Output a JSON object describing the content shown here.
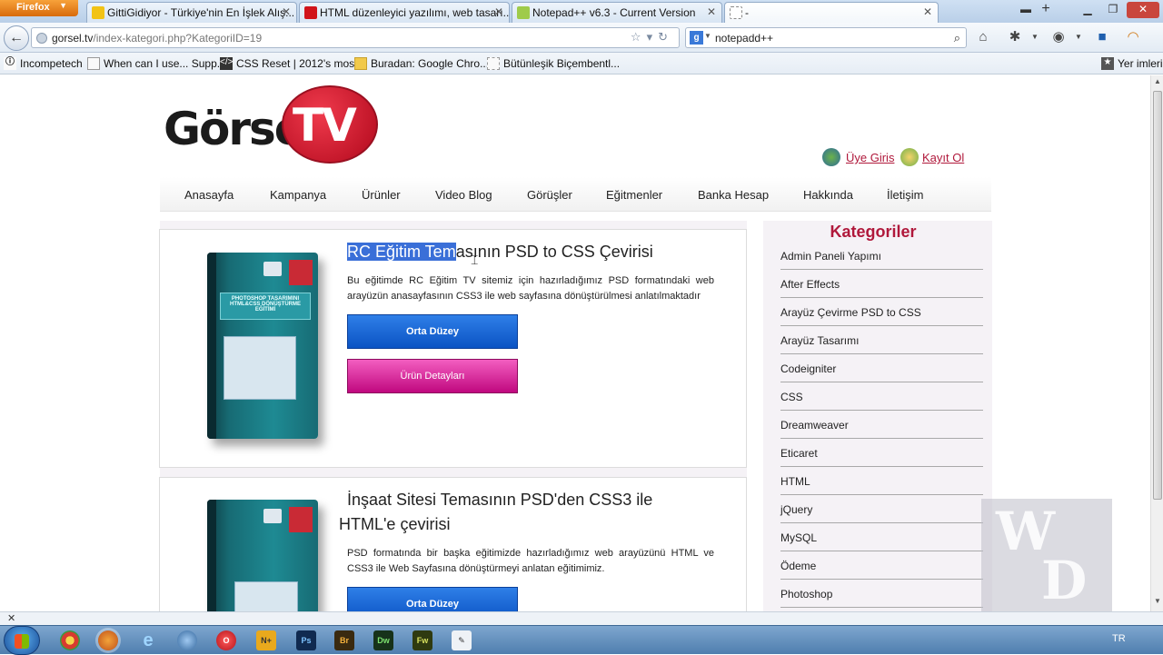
{
  "browser": {
    "app_button": "Firefox",
    "tabs": [
      {
        "title": "GittiGidiyor - Türkiye'nin En İşlek Alış...",
        "active": false
      },
      {
        "title": "HTML düzenleyici yazılımı, web tasarı...",
        "active": false
      },
      {
        "title": "Notepad++ v6.3 - Current Version",
        "active": false
      },
      {
        "title": "-",
        "active": true
      }
    ],
    "url_host": "gorsel.tv",
    "url_path": "/index-kategori.php?KategoriID=19",
    "search_value": "notepadd++",
    "bookmarks": [
      "Incompetech",
      "When can I use... Supp...",
      "CSS Reset | 2012's mos...",
      "Buradan: Google Chro...",
      "Bütünleşik Biçembentl..."
    ],
    "bookmarks_right": "Yer imleri"
  },
  "site": {
    "logo_word": "Görsel",
    "logo_tv": "TV",
    "login_label": "Üye Giris",
    "register_label": "Kayıt Ol",
    "menu": [
      "Anasayfa",
      "Kampanya",
      "Ürünler",
      "Video Blog",
      "Görüşler",
      "Eğitmenler",
      "Banka Hesap",
      "Hakkında",
      "İletişim"
    ]
  },
  "courses": [
    {
      "title_highlight": "RC Eğitim Tem",
      "title_rest": "asının PSD to CSS Çevirisi",
      "description": "Bu eğitimde RC Eğitim TV sitemiz için hazırladığımız PSD formatındaki web arayüzün anasayfasının CSS3 ile web sayfasına dönüştürülmesi anlatılmaktadır",
      "level_label": "Orta Düzey",
      "detail_label": "Ürün Detayları",
      "box_band": "PHOTOSHOP TASARIMINI HTML&CSS DÖNÜŞTÜRME EĞİTİMİ"
    },
    {
      "title_line1": "İnşaat Sitesi Temasının PSD'den CSS3 ile",
      "title_line2": "HTML'e çevirisi",
      "description": "PSD formatında bir başka eğitimizde hazırladığımız web arayüzünü HTML ve CSS3 ile Web Sayfasına dönüştürmeyi anlatan eğitimimiz.",
      "level_label": "Orta Düzey"
    }
  ],
  "sidebar": {
    "title": "Kategoriler",
    "categories": [
      "Admin Paneli Yapımı",
      "After Effects",
      "Arayüz Çevirme PSD to CSS",
      "Arayüz Tasarımı",
      "Codeigniter",
      "CSS",
      "Dreamweaver",
      "Eticaret",
      "HTML",
      "jQuery",
      "MySQL",
      "Ödeme",
      "Photoshop"
    ]
  },
  "watermark": {
    "w": "W",
    "d": "D"
  },
  "taskbar": {
    "language": "TR",
    "apps": [
      "Chrome",
      "Firefox",
      "Internet Explorer",
      "Globe",
      "Opera",
      "Notepad++",
      "Ps",
      "Br",
      "Dw",
      "Fw",
      "Notepad"
    ]
  },
  "colors": {
    "accent": "#b0183b",
    "link_blue": "#0a53c4",
    "detail_pink": "#c0087f",
    "highlight": "#3a6fd8"
  }
}
